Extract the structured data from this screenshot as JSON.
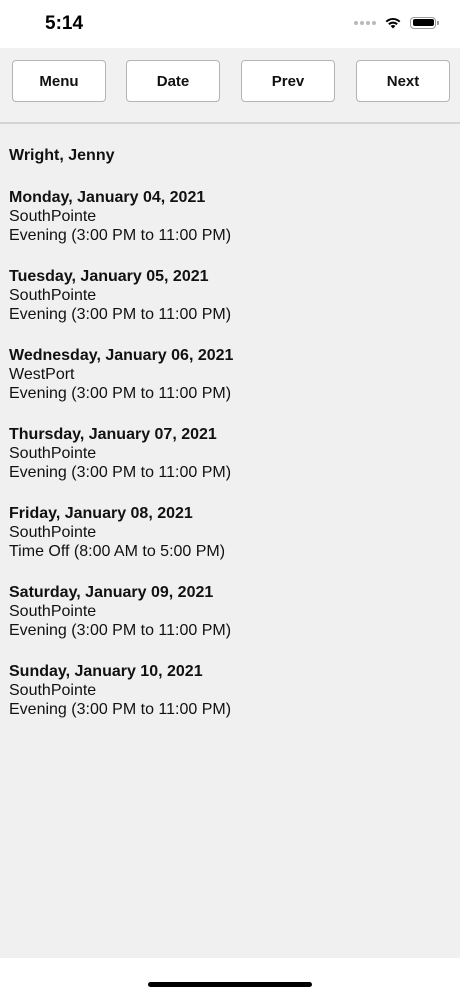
{
  "status_bar": {
    "time": "5:14"
  },
  "toolbar": {
    "menu_label": "Menu",
    "date_label": "Date",
    "prev_label": "Prev",
    "next_label": "Next"
  },
  "schedule": {
    "employee_name": "Wright, Jenny",
    "shifts": [
      {
        "date": "Monday, January 04, 2021",
        "location": "SouthPointe",
        "time": "Evening (3:00 PM to 11:00 PM)"
      },
      {
        "date": "Tuesday, January 05, 2021",
        "location": "SouthPointe",
        "time": "Evening (3:00 PM to 11:00 PM)"
      },
      {
        "date": "Wednesday, January 06, 2021",
        "location": "WestPort",
        "time": "Evening (3:00 PM to 11:00 PM)"
      },
      {
        "date": "Thursday, January 07, 2021",
        "location": "SouthPointe",
        "time": "Evening (3:00 PM to 11:00 PM)"
      },
      {
        "date": "Friday, January 08, 2021",
        "location": "SouthPointe",
        "time": "Time Off (8:00 AM to 5:00 PM)"
      },
      {
        "date": "Saturday, January 09, 2021",
        "location": "SouthPointe",
        "time": "Evening (3:00 PM to 11:00 PM)"
      },
      {
        "date": "Sunday, January 10, 2021",
        "location": "SouthPointe",
        "time": "Evening (3:00 PM to 11:00 PM)"
      }
    ]
  }
}
